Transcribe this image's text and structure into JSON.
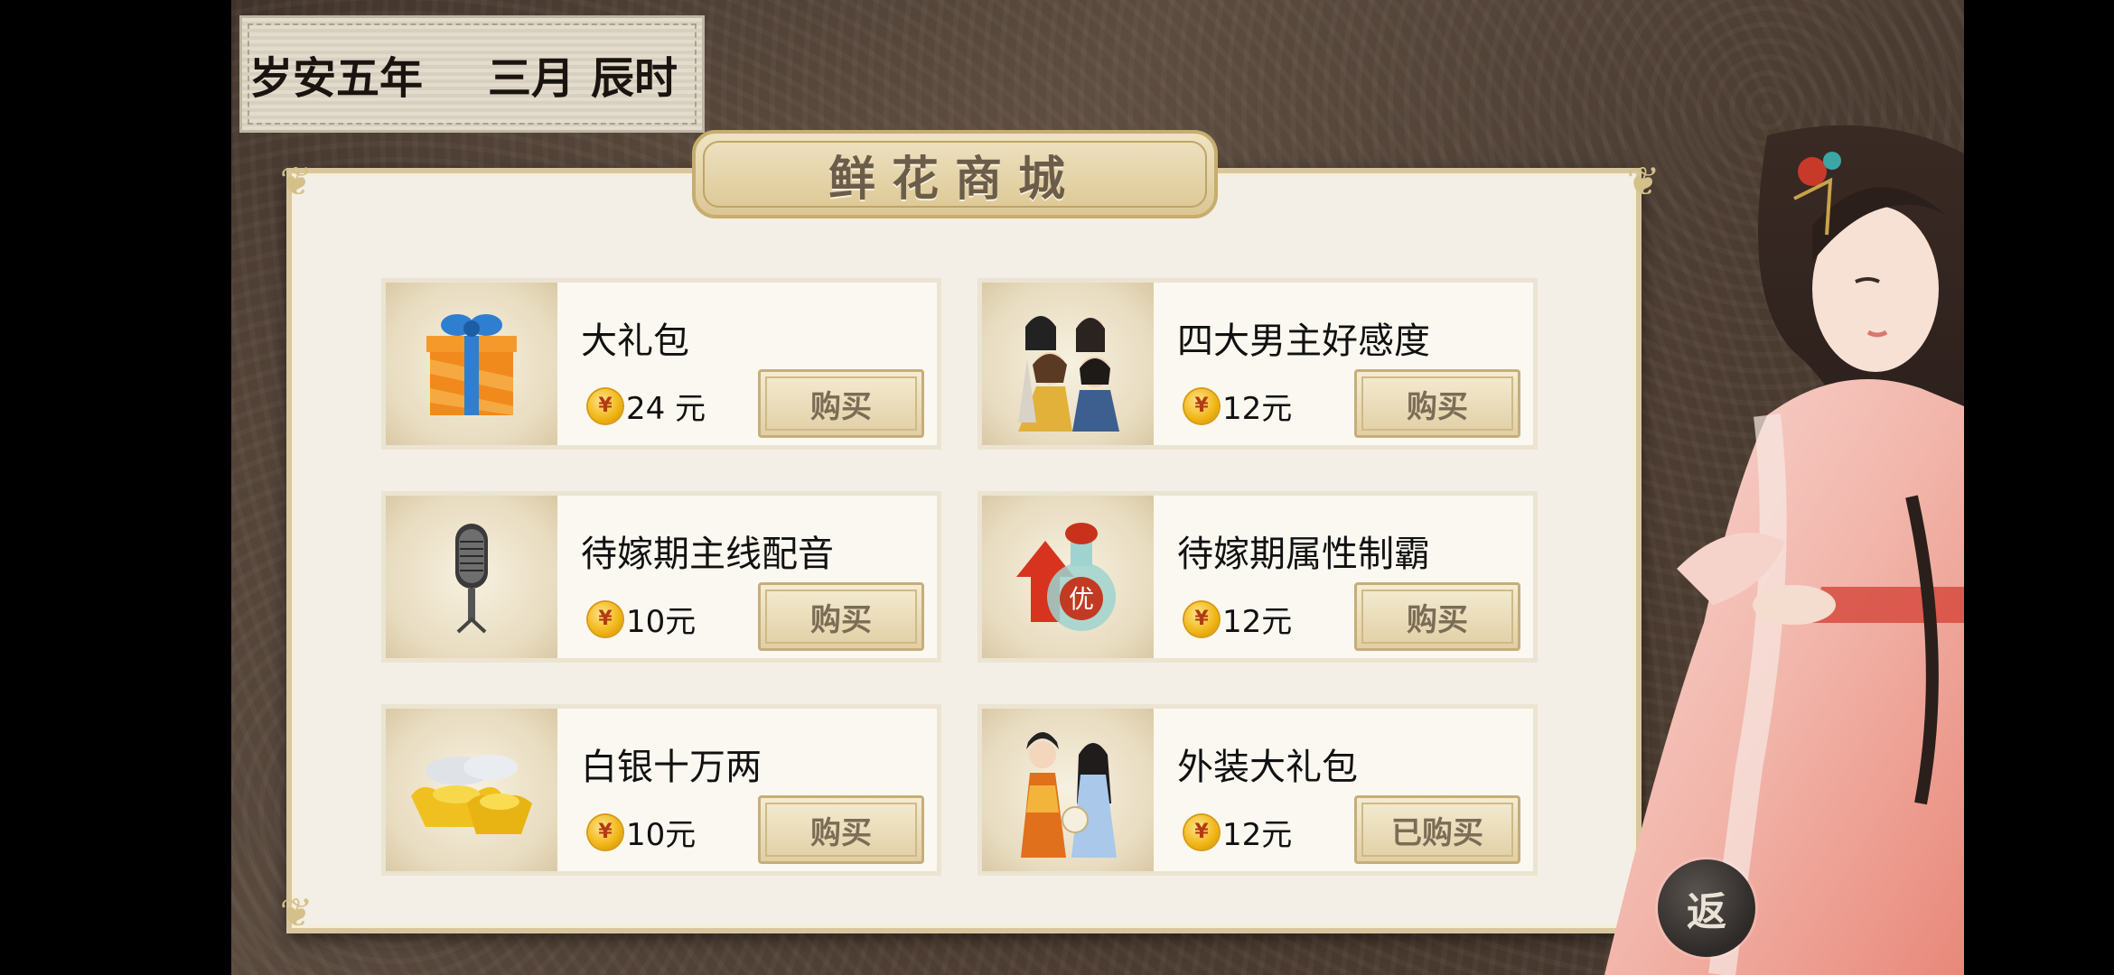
{
  "date": {
    "era": "岁安五年",
    "month": "三月",
    "hour": "辰时"
  },
  "shop": {
    "title": "鲜花商城",
    "items": [
      {
        "name": "大礼包",
        "price": "24 元",
        "button": "购买",
        "icon": "gift-box-icon"
      },
      {
        "name": "四大男主好感度",
        "price": "12元",
        "button": "购买",
        "icon": "four-men-portrait-icon"
      },
      {
        "name": "待嫁期主线配音",
        "price": "10元",
        "button": "购买",
        "icon": "microphone-icon"
      },
      {
        "name": "待嫁期属性制霸",
        "price": "12元",
        "button": "购买",
        "icon": "potion-bottle-icon"
      },
      {
        "name": "白银十万两",
        "price": "10元",
        "button": "购买",
        "icon": "silver-ingots-icon"
      },
      {
        "name": "外装大礼包",
        "price": "12元",
        "button": "已购买",
        "icon": "costume-pair-icon"
      }
    ],
    "coin_symbol": "¥"
  },
  "back_button": "返",
  "colors": {
    "panel": "#f3efe6",
    "gold": "#d8c79e",
    "background": "#4a3b31"
  }
}
